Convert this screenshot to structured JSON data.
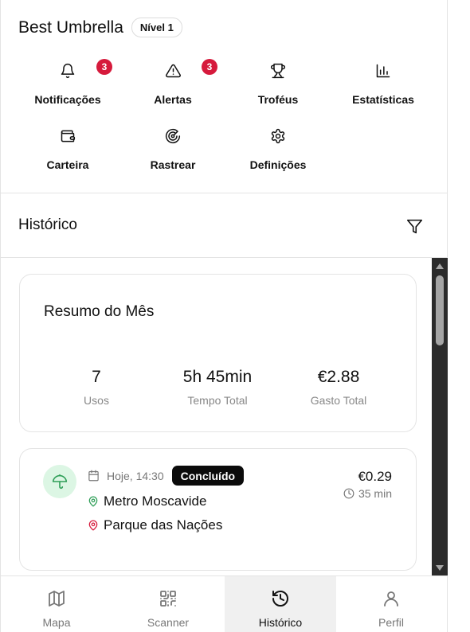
{
  "header": {
    "title": "Best Umbrella",
    "level": "Nível 1",
    "actions": [
      {
        "label": "Notificações",
        "icon": "bell-icon",
        "badge": "3"
      },
      {
        "label": "Alertas",
        "icon": "warning-icon",
        "badge": "3"
      },
      {
        "label": "Troféus",
        "icon": "trophy-icon"
      },
      {
        "label": "Estatísticas",
        "icon": "bar-chart-icon"
      },
      {
        "label": "Carteira",
        "icon": "wallet-icon"
      },
      {
        "label": "Rastrear",
        "icon": "radar-icon"
      },
      {
        "label": "Definições",
        "icon": "gear-icon"
      }
    ]
  },
  "history": {
    "title": "Histórico",
    "filter_icon": "filter-icon"
  },
  "summary": {
    "title": "Resumo do Mês",
    "stats": [
      {
        "value": "7",
        "label": "Usos"
      },
      {
        "value": "5h 45min",
        "label": "Tempo Total"
      },
      {
        "value": "€2.88",
        "label": "Gasto Total"
      }
    ]
  },
  "trips": [
    {
      "date": "Hoje, 14:30",
      "status": "Concluído",
      "origin": "Metro Moscavide",
      "destination": "Parque das Nações",
      "price": "€0.29",
      "duration": "35 min"
    }
  ],
  "nav": [
    {
      "label": "Mapa",
      "icon": "map-icon"
    },
    {
      "label": "Scanner",
      "icon": "qr-code-icon"
    },
    {
      "label": "Histórico",
      "icon": "history-icon",
      "active": true
    },
    {
      "label": "Perfil",
      "icon": "user-icon"
    }
  ],
  "colors": {
    "badge_red": "#d61a3c",
    "umbrella_green": "#2e9e57",
    "avatar_green_bg": "#dcf6e4",
    "origin_pin": "#2e9e57",
    "destination_pin": "#d61a3c",
    "status_bg": "#0b0b0b"
  }
}
